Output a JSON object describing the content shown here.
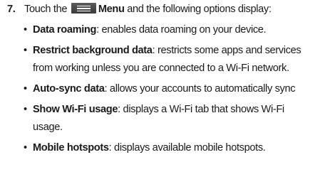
{
  "step": {
    "number": "7.",
    "text_before": "Touch the",
    "icon": "menu-icon",
    "menu_label": "Menu",
    "text_after": " and the following options display:"
  },
  "options": [
    {
      "term": "Data roaming",
      "desc_lines": [
        ": enables data roaming on your device."
      ]
    },
    {
      "term": "Restrict background data",
      "desc_lines": [
        ": restricts some apps and services",
        "from working unless you are connected to a Wi-Fi network."
      ]
    },
    {
      "term": "Auto-sync data",
      "desc_lines": [
        ": allows your accounts to automatically sync"
      ]
    },
    {
      "term": "Show Wi-Fi usage",
      "desc_lines": [
        ": displays a Wi-Fi tab that shows Wi-Fi",
        "usage."
      ]
    },
    {
      "term": "Mobile hotspots",
      "desc_lines": [
        ": displays available mobile hotspots."
      ]
    }
  ]
}
